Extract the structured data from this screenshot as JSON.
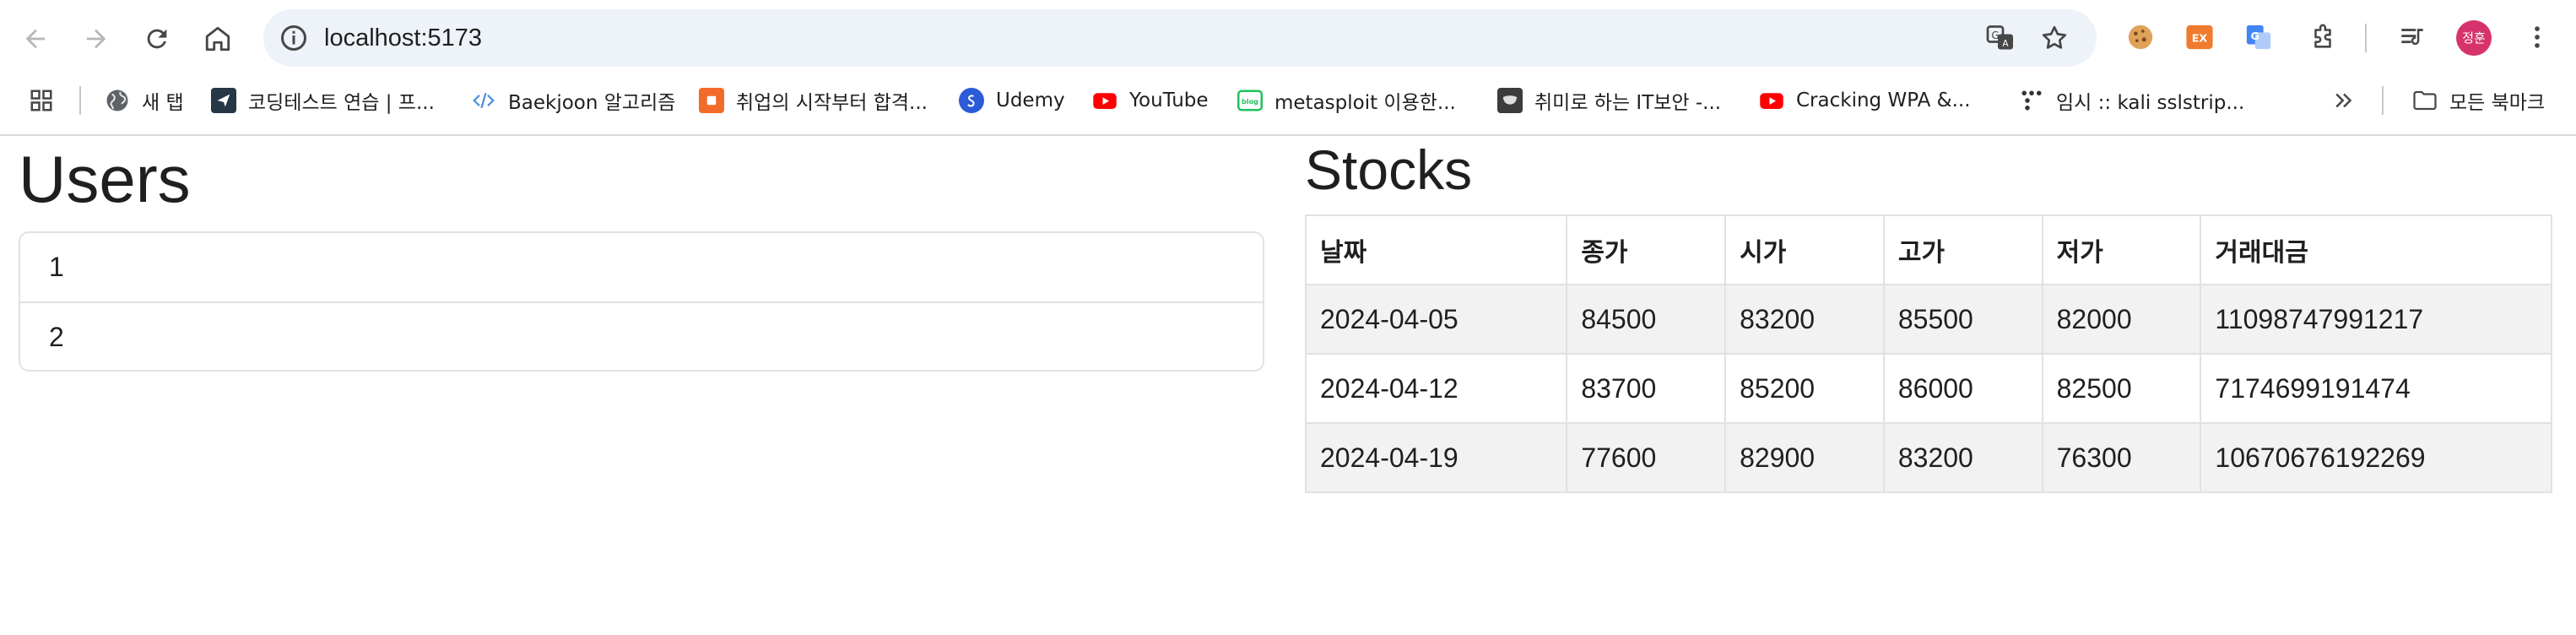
{
  "browser": {
    "url": "localhost:5173",
    "profile_initials": "정훈",
    "bookmarks": [
      {
        "label": "새 탭",
        "icon": "globe-icon"
      },
      {
        "label": "코딩테스트 연습 | 프...",
        "icon": "programmers-icon"
      },
      {
        "label": "Baekjoon 알고리즘",
        "icon": "code-icon"
      },
      {
        "label": "취업의 시작부터 합격...",
        "icon": "orange-square-icon"
      },
      {
        "label": "Udemy",
        "icon": "udemy-icon"
      },
      {
        "label": "YouTube",
        "icon": "youtube-icon"
      },
      {
        "label": "metasploit 이용한...",
        "icon": "blog-icon"
      },
      {
        "label": "취미로 하는 IT보안 -...",
        "icon": "mask-icon"
      },
      {
        "label": "Cracking WPA &...",
        "icon": "youtube-icon"
      },
      {
        "label": "임시 :: kali sslstrip...",
        "icon": "dots-icon"
      }
    ],
    "all_bookmarks_label": "모든 북마크"
  },
  "users": {
    "title": "Users",
    "items": [
      "1",
      "2"
    ]
  },
  "stocks": {
    "title": "Stocks",
    "columns": [
      "날짜",
      "종가",
      "시가",
      "고가",
      "저가",
      "거래대금"
    ],
    "rows": [
      [
        "2024-04-05",
        "84500",
        "83200",
        "85500",
        "82000",
        "11098747991217"
      ],
      [
        "2024-04-12",
        "83700",
        "85200",
        "86000",
        "82500",
        "7174699191474"
      ],
      [
        "2024-04-19",
        "77600",
        "82900",
        "83200",
        "76300",
        "10670676192269"
      ]
    ]
  },
  "colors": {
    "profile": "#d6336c",
    "omnibox": "#eef2f9",
    "striped_row": "#f2f2f2",
    "border": "#dee2e6"
  }
}
